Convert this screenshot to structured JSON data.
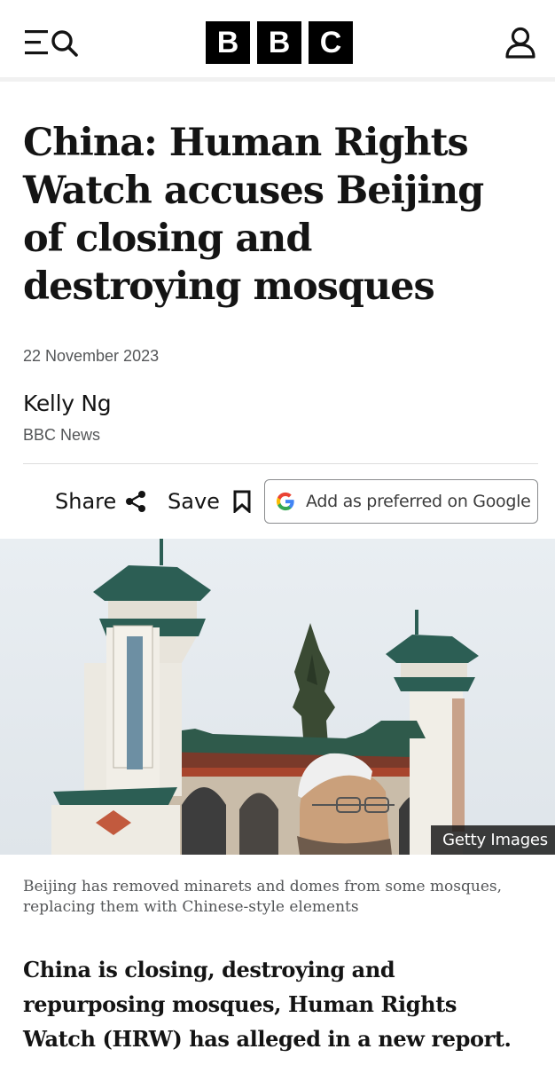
{
  "header": {
    "logo_letters": [
      "B",
      "B",
      "C"
    ],
    "menu_icon": "menu-search-icon",
    "account_icon": "account-icon"
  },
  "article": {
    "headline": "China: Human Rights Watch accuses Beijing of closing and destroying mosques",
    "date": "22 November 2023",
    "author": "Kelly Ng",
    "publisher": "BBC News",
    "share_label": "Share",
    "save_label": "Save",
    "google_label": "Add as preferred on Google",
    "image_credit": "Getty Images",
    "caption": "Beijing has removed minarets and domes from some mosques, replacing them with Chinese-style elements",
    "lede": "China is closing, destroying and repurposing mosques, Human Rights Watch (HRW) has alleged in a new report."
  },
  "icons": {
    "share": "share-icon",
    "save": "bookmark-icon",
    "google": "google-g-icon"
  },
  "colors": {
    "text": "#141414",
    "muted": "#545658",
    "logo_bg": "#000000"
  }
}
